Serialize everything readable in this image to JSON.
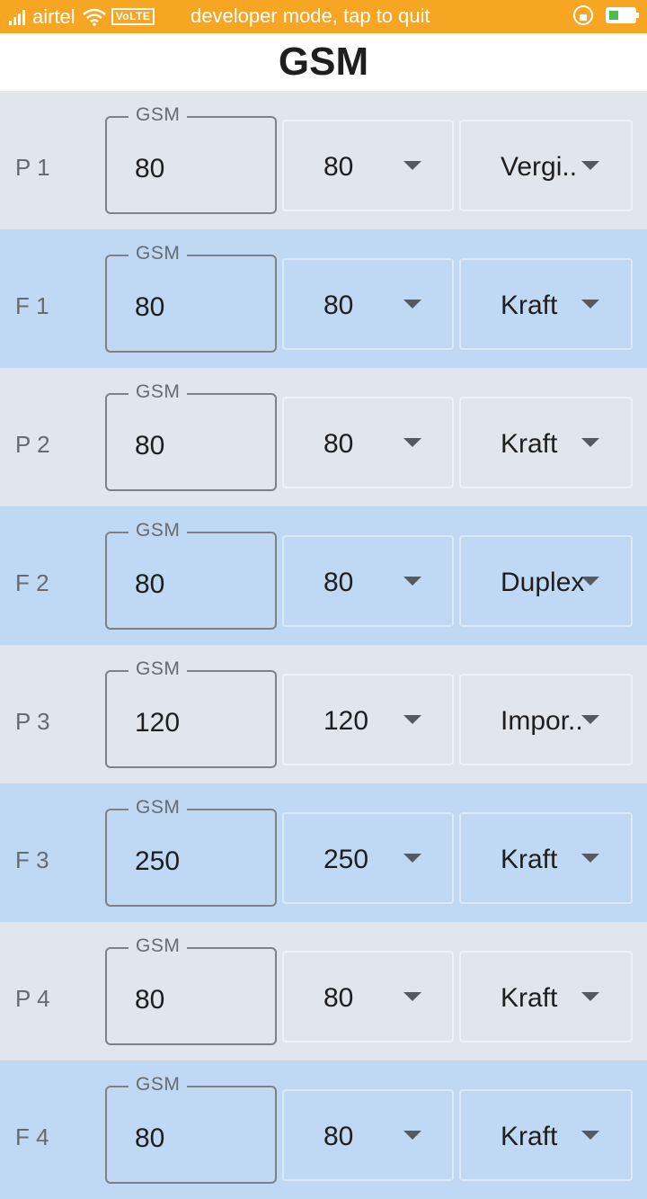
{
  "status_bar": {
    "carrier": "airtel",
    "volte": "VoLTE",
    "notice": "developer mode, tap to quit",
    "icons": [
      "signal-icon",
      "wifi-icon",
      "rotation-lock-icon",
      "battery-charging-icon"
    ]
  },
  "app_bar": {
    "title": "GSM"
  },
  "colors": {
    "status_bar": "#f6a623",
    "row_even": "#e1e6ed",
    "row_odd": "#bfd9f4"
  },
  "rows": [
    {
      "label": "P 1",
      "field_label": "GSM",
      "gsm": "80",
      "select_gsm": "80",
      "paper_type": "Vergi.."
    },
    {
      "label": "F 1",
      "field_label": "GSM",
      "gsm": "80",
      "select_gsm": "80",
      "paper_type": "Kraft"
    },
    {
      "label": "P 2",
      "field_label": "GSM",
      "gsm": "80",
      "select_gsm": "80",
      "paper_type": "Kraft"
    },
    {
      "label": "F 2",
      "field_label": "GSM",
      "gsm": "80",
      "select_gsm": "80",
      "paper_type": "Duplex"
    },
    {
      "label": "P 3",
      "field_label": "GSM",
      "gsm": "120",
      "select_gsm": "120",
      "paper_type": "Impor.."
    },
    {
      "label": "F 3",
      "field_label": "GSM",
      "gsm": "250",
      "select_gsm": "250",
      "paper_type": "Kraft"
    },
    {
      "label": "P 4",
      "field_label": "GSM",
      "gsm": "80",
      "select_gsm": "80",
      "paper_type": "Kraft"
    },
    {
      "label": "F 4",
      "field_label": "GSM",
      "gsm": "80",
      "select_gsm": "80",
      "paper_type": "Kraft"
    }
  ]
}
